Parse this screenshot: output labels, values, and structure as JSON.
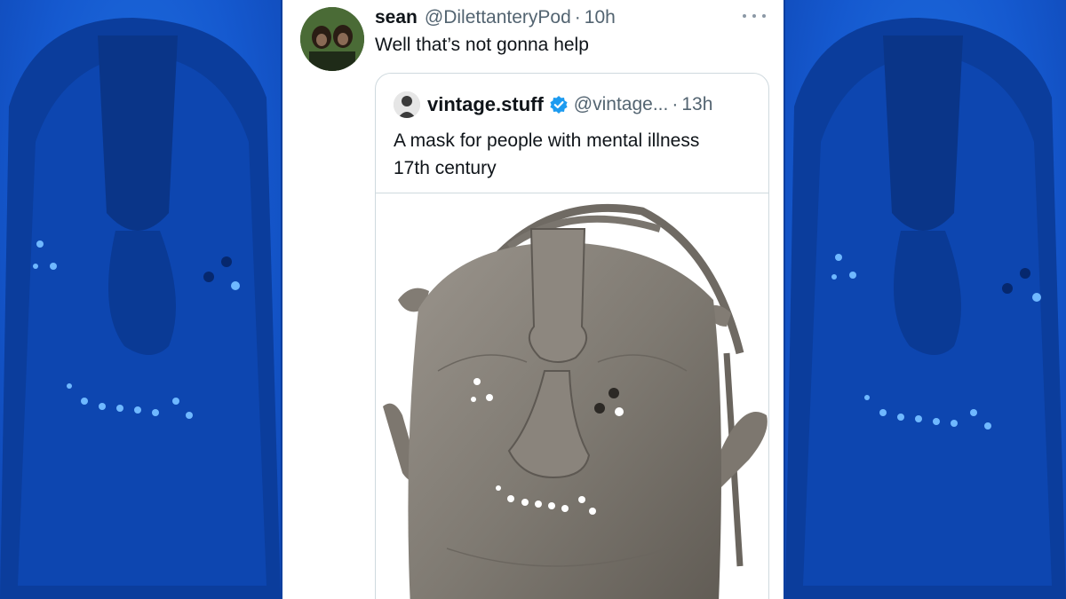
{
  "tweet": {
    "author_name": "sean",
    "author_handle": "@DilettanteryPod",
    "separator": "·",
    "timestamp": "10h",
    "text": "Well that’s not gonna help",
    "more_icon": "more-horizontal-icon"
  },
  "quoted_tweet": {
    "author_name": "vintage.stuff",
    "verified_icon": "verified-badge-icon",
    "author_handle": "@vintage...",
    "separator": "·",
    "timestamp": "13h",
    "text_line_1": "A mask for people with mental illness",
    "text_line_2": "17th century",
    "media_description": "mask-photo"
  },
  "colors": {
    "background_blue": "#1565d8",
    "card_background": "#ffffff",
    "secondary_text": "#536471",
    "verified_blue": "#1d9bf0",
    "border": "#cfd9de"
  }
}
